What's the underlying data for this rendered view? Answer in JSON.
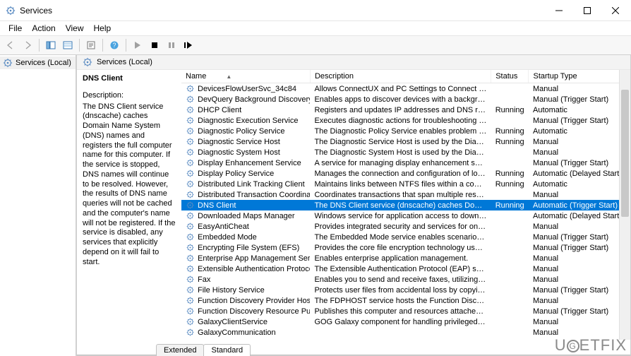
{
  "window": {
    "title": "Services"
  },
  "menu": [
    "File",
    "Action",
    "View",
    "Help"
  ],
  "sidebar": {
    "root": "Services (Local)"
  },
  "pane": {
    "header": "Services (Local)",
    "selected_service_name": "DNS Client",
    "description_heading": "Description:",
    "description_text": "The DNS Client service (dnscache) caches Domain Name System (DNS) names and registers the full computer name for this computer. If the service is stopped, DNS names will continue to be resolved. However, the results of DNS name queries will not be cached and the computer's name will not be registered. If the service is disabled, any services that explicitly depend on it will fail to start."
  },
  "columns": [
    "Name",
    "Description",
    "Status",
    "Startup Type"
  ],
  "sort_column": 0,
  "services": [
    {
      "name": "DevicesFlowUserSvc_34c84",
      "desc": "Allows ConnectUX and PC Settings to Connect and Pair wit...",
      "status": "",
      "startup": "Manual"
    },
    {
      "name": "DevQuery Background Discovery Broker",
      "desc": "Enables apps to discover devices with a backgroud task",
      "status": "",
      "startup": "Manual (Trigger Start)"
    },
    {
      "name": "DHCP Client",
      "desc": "Registers and updates IP addresses and DNS records for thi...",
      "status": "Running",
      "startup": "Automatic"
    },
    {
      "name": "Diagnostic Execution Service",
      "desc": "Executes diagnostic actions for troubleshooting support",
      "status": "",
      "startup": "Manual (Trigger Start)"
    },
    {
      "name": "Diagnostic Policy Service",
      "desc": "The Diagnostic Policy Service enables problem detection, tr...",
      "status": "Running",
      "startup": "Automatic"
    },
    {
      "name": "Diagnostic Service Host",
      "desc": "The Diagnostic Service Host is used by the Diagnostic Polic...",
      "status": "Running",
      "startup": "Manual"
    },
    {
      "name": "Diagnostic System Host",
      "desc": "The Diagnostic System Host is used by the Diagnostic Polic...",
      "status": "",
      "startup": "Manual"
    },
    {
      "name": "Display Enhancement Service",
      "desc": "A service for managing display enhancement such as brigh...",
      "status": "",
      "startup": "Manual (Trigger Start)"
    },
    {
      "name": "Display Policy Service",
      "desc": "Manages the connection and configuration of local and re...",
      "status": "Running",
      "startup": "Automatic (Delayed Start)"
    },
    {
      "name": "Distributed Link Tracking Client",
      "desc": "Maintains links between NTFS files within a computer or ac...",
      "status": "Running",
      "startup": "Automatic"
    },
    {
      "name": "Distributed Transaction Coordinator",
      "desc": "Coordinates transactions that span multiple resource mana...",
      "status": "",
      "startup": "Manual"
    },
    {
      "name": "DNS Client",
      "desc": "The DNS Client service (dnscache) caches Domain Name S...",
      "status": "Running",
      "startup": "Automatic (Trigger Start)",
      "selected": true
    },
    {
      "name": "Downloaded Maps Manager",
      "desc": "Windows service for application access to downloaded ma...",
      "status": "",
      "startup": "Automatic (Delayed Start)"
    },
    {
      "name": "EasyAntiCheat",
      "desc": "Provides integrated security and services for online multipl...",
      "status": "",
      "startup": "Manual"
    },
    {
      "name": "Embedded Mode",
      "desc": "The Embedded Mode service enables scenarios related to B...",
      "status": "",
      "startup": "Manual (Trigger Start)"
    },
    {
      "name": "Encrypting File System (EFS)",
      "desc": "Provides the core file encryption technology used to store ...",
      "status": "",
      "startup": "Manual (Trigger Start)"
    },
    {
      "name": "Enterprise App Management Service",
      "desc": "Enables enterprise application management.",
      "status": "",
      "startup": "Manual"
    },
    {
      "name": "Extensible Authentication Protocol",
      "desc": "The Extensible Authentication Protocol (EAP) service provi...",
      "status": "",
      "startup": "Manual"
    },
    {
      "name": "Fax",
      "desc": "Enables you to send and receive faxes, utilizing fax resourc...",
      "status": "",
      "startup": "Manual"
    },
    {
      "name": "File History Service",
      "desc": "Protects user files from accidental loss by copying them to ...",
      "status": "",
      "startup": "Manual (Trigger Start)"
    },
    {
      "name": "Function Discovery Provider Host",
      "desc": "The FDPHOST service hosts the Function Discovery (FD) net...",
      "status": "",
      "startup": "Manual"
    },
    {
      "name": "Function Discovery Resource Publication",
      "desc": "Publishes this computer and resources attached to this co...",
      "status": "",
      "startup": "Manual (Trigger Start)"
    },
    {
      "name": "GalaxyClientService",
      "desc": "GOG Galaxy component for handling privileged tasks.",
      "status": "",
      "startup": "Manual"
    },
    {
      "name": "GalaxyCommunication",
      "desc": "",
      "status": "",
      "startup": "Manual"
    }
  ],
  "tabs": [
    "Extended",
    "Standard"
  ],
  "active_tab": 1,
  "watermark": "UGETFIX"
}
